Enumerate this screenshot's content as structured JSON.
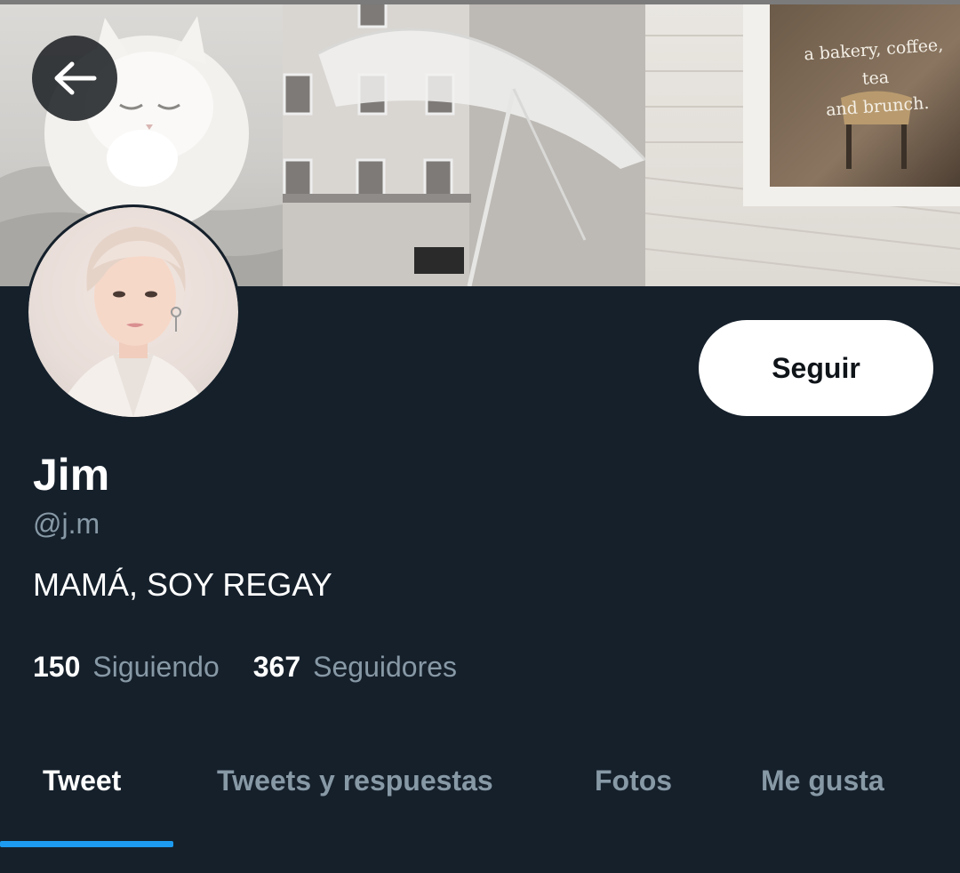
{
  "header": {
    "banner_text": "a bakery, coffee, tea\nand brunch.",
    "back_button": {
      "icon": "arrow-left-icon"
    }
  },
  "profile": {
    "avatar_icon": "avatar",
    "name": "Jim",
    "handle": "@j.m",
    "bio": "MAMÁ, SOY REGAY",
    "follow_label": "Seguir",
    "following_count": "150",
    "following_label": "Siguiendo",
    "followers_count": "367",
    "followers_label": "Seguidores"
  },
  "tabs": [
    {
      "label": "Tweet",
      "active": true
    },
    {
      "label": "Tweets y respuestas",
      "active": false
    },
    {
      "label": "Fotos",
      "active": false
    },
    {
      "label": "Me gusta",
      "active": false
    }
  ],
  "colors": {
    "background": "#15202b",
    "accent": "#1d9bf0",
    "secondary_text": "#8899a6",
    "primary_text": "#ffffff"
  }
}
